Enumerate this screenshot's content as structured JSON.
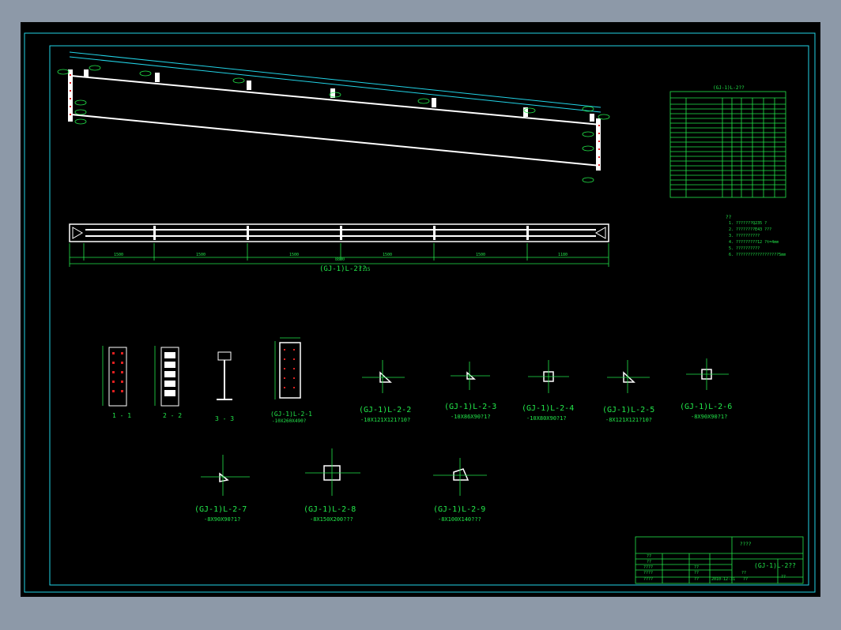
{
  "drawing": {
    "elevation_title": "(GJ-1)L-2??",
    "elevation_scale": "1:15",
    "overall_dim": "8800",
    "seg_dims": [
      "1500",
      "1500",
      "1500",
      "1500",
      "1500",
      "1180"
    ],
    "section_labels": [
      "1 - 1",
      "2 - 2",
      "3 - 3"
    ],
    "plate_2_1_title": "(GJ-1)L-2-1",
    "plate_2_1_sub": "-10X260X490?",
    "details": [
      {
        "title": "(GJ-1)L-2-2",
        "sub": "-10X121X121?10?"
      },
      {
        "title": "(GJ-1)L-2-3",
        "sub": "-10X86X90?1?"
      },
      {
        "title": "(GJ-1)L-2-4",
        "sub": "-10X80X90?1?"
      },
      {
        "title": "(GJ-1)L-2-5",
        "sub": "-8X121X121?10?"
      },
      {
        "title": "(GJ-1)L-2-6",
        "sub": "-8X90X90?1?"
      },
      {
        "title": "(GJ-1)L-2-7",
        "sub": "-8X90X90?1?"
      },
      {
        "title": "(GJ-1)L-2-8",
        "sub": "-8X150X200???"
      },
      {
        "title": "(GJ-1)L-2-9",
        "sub": "-8X100X140???"
      }
    ],
    "table_title": "(GJ-1)L-2??",
    "notes_title": "??",
    "notes": [
      "1. ???????Q235 ?",
      "2. ????????E43 ???",
      "3. ??????????",
      "4. ?????????12 ?t=4mm",
      "5. ??????????",
      "6. ??????????????????5mm"
    ]
  },
  "title_block": {
    "project": "????",
    "drawing_name": "(GJ-1)L-2??",
    "rows": [
      "??",
      "??",
      "????",
      "????",
      "????"
    ],
    "values": [
      "??",
      "??",
      "??"
    ],
    "date": "2010-12-31",
    "stage": "??",
    "sheet": "??",
    "code": "??"
  },
  "colors": {
    "background": "#000000",
    "frame": "#22d3e6",
    "text": "#22e64a",
    "member": "#ffffff",
    "bolt": "#e02020"
  }
}
